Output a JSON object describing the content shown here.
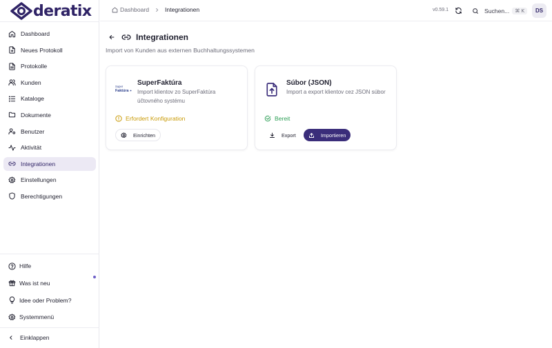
{
  "brand": {
    "name": "deratix",
    "color": "#2f2366"
  },
  "sidebar": {
    "items": [
      {
        "label": "Dashboard",
        "icon": "home-icon"
      },
      {
        "label": "Neues Protokoll",
        "icon": "file-plus-icon"
      },
      {
        "label": "Protokolle",
        "icon": "file-text-icon"
      },
      {
        "label": "Kunden",
        "icon": "users-icon"
      },
      {
        "label": "Kataloge",
        "icon": "list-icon"
      },
      {
        "label": "Dokumente",
        "icon": "folder-icon"
      },
      {
        "label": "Benutzer",
        "icon": "user-cog-icon"
      },
      {
        "label": "Aktivität",
        "icon": "activity-icon"
      },
      {
        "label": "Integrationen",
        "icon": "link-icon",
        "active": true
      },
      {
        "label": "Einstellungen",
        "icon": "gear-icon"
      },
      {
        "label": "Berechtigungen",
        "icon": "shield-icon"
      }
    ],
    "footer": [
      {
        "label": "Hilfe",
        "icon": "help-circle-icon"
      },
      {
        "label": "Was ist neu",
        "icon": "gift-icon"
      },
      {
        "label": "Idee oder Problem?",
        "icon": "lightbulb-icon"
      },
      {
        "label": "Systemmenü",
        "icon": "settings-icon"
      }
    ],
    "collapse_label": "Einklappen"
  },
  "header": {
    "breadcrumb_home": "Dashboard",
    "breadcrumb_current": "Integrationen",
    "version": "v0.59.1",
    "search_label": "Suchen...",
    "search_shortcut": "⌘ K",
    "avatar_initials": "DS"
  },
  "page": {
    "title": "Integrationen",
    "subtitle": "Import von Kunden aus externen Buchhaltungssystemen"
  },
  "cards": [
    {
      "logo_text": "Super Faktúra",
      "name": "SuperFaktúra",
      "description": "Import klientov zo SuperFaktúra účtovného systému",
      "status": "Erfordert Konfiguration",
      "status_color": "#c99a06",
      "button": "Einrichten"
    },
    {
      "name": "Súbor (JSON)",
      "description": "Import a export klientov cez JSON súbor",
      "status": "Bereit",
      "status_color": "#2e9f57",
      "export_button": "Export",
      "import_button": "Importieren",
      "accent": "#3a2d7a"
    }
  ]
}
